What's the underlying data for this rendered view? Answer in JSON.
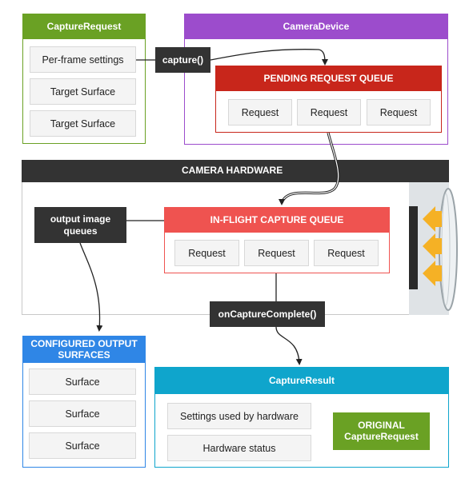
{
  "capture_request": {
    "title": "CaptureRequest",
    "items": [
      "Per-frame settings",
      "Target Surface",
      "Target Surface"
    ]
  },
  "capture_call": "capture()",
  "camera_device": {
    "title": "CameraDevice",
    "pending_queue": {
      "title": "PENDING REQUEST QUEUE",
      "items": [
        "Request",
        "Request",
        "Request"
      ]
    }
  },
  "camera_hardware": {
    "title": "CAMERA HARDWARE",
    "output_image_queues": "output image queues",
    "in_flight_queue": {
      "title": "IN-FLIGHT CAPTURE QUEUE",
      "items": [
        "Request",
        "Request",
        "Request"
      ]
    }
  },
  "on_capture_complete": "onCaptureComplete()",
  "configured_output": {
    "title": "CONFIGURED OUTPUT SURFACES",
    "items": [
      "Surface",
      "Surface",
      "Surface"
    ]
  },
  "capture_result": {
    "title": "CaptureResult",
    "items": [
      "Settings used by hardware",
      "Hardware status"
    ],
    "original": "ORIGINAL CaptureRequest"
  },
  "colors": {
    "green": "#6aa124",
    "purple": "#9c4ccc",
    "red_dark": "#c8261b",
    "red_light": "#ef5350",
    "dark": "#333333",
    "blue": "#2f86e6",
    "teal": "#0fa5cc",
    "orange": "#f5b125"
  }
}
